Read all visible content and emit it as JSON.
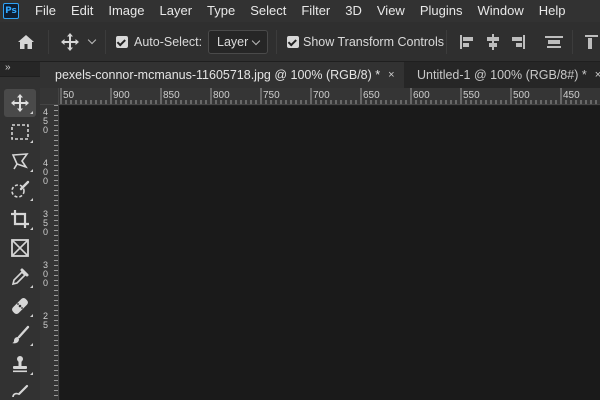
{
  "app": {
    "logo_text": "Ps"
  },
  "menu": [
    "File",
    "Edit",
    "Image",
    "Layer",
    "Type",
    "Select",
    "Filter",
    "3D",
    "View",
    "Plugins",
    "Window",
    "Help"
  ],
  "options": {
    "auto_select_label": "Auto-Select:",
    "auto_select_checked": true,
    "target_value": "Layer",
    "show_transform_label": "Show Transform Controls",
    "show_transform_checked": true
  },
  "tabs": [
    {
      "label": "pexels-connor-mcmanus-11605718.jpg @ 100% (RGB/8) *",
      "close": "×",
      "active": true
    },
    {
      "label": "Untitled-1 @ 100% (RGB/8#) *",
      "close": "×",
      "active": false
    }
  ],
  "toolbar": {
    "collapse_label": "»"
  },
  "rulers": {
    "horizontal_ticks": [
      "50",
      "900",
      "850",
      "800",
      "750",
      "700",
      "650",
      "600",
      "550",
      "500",
      "450"
    ],
    "vertical_ticks": [
      "4",
      "5",
      "0",
      "4",
      "0",
      "0",
      "3",
      "5",
      "0",
      "3",
      "0",
      "0",
      "2",
      "5"
    ]
  },
  "colors": {
    "menubar_bg": "#323232",
    "optionsbar_bg": "#2f2f2f",
    "canvas_bg": "#1a1a1a",
    "active_tab_bg": "#323232",
    "ps_blue": "#31a8ff"
  }
}
